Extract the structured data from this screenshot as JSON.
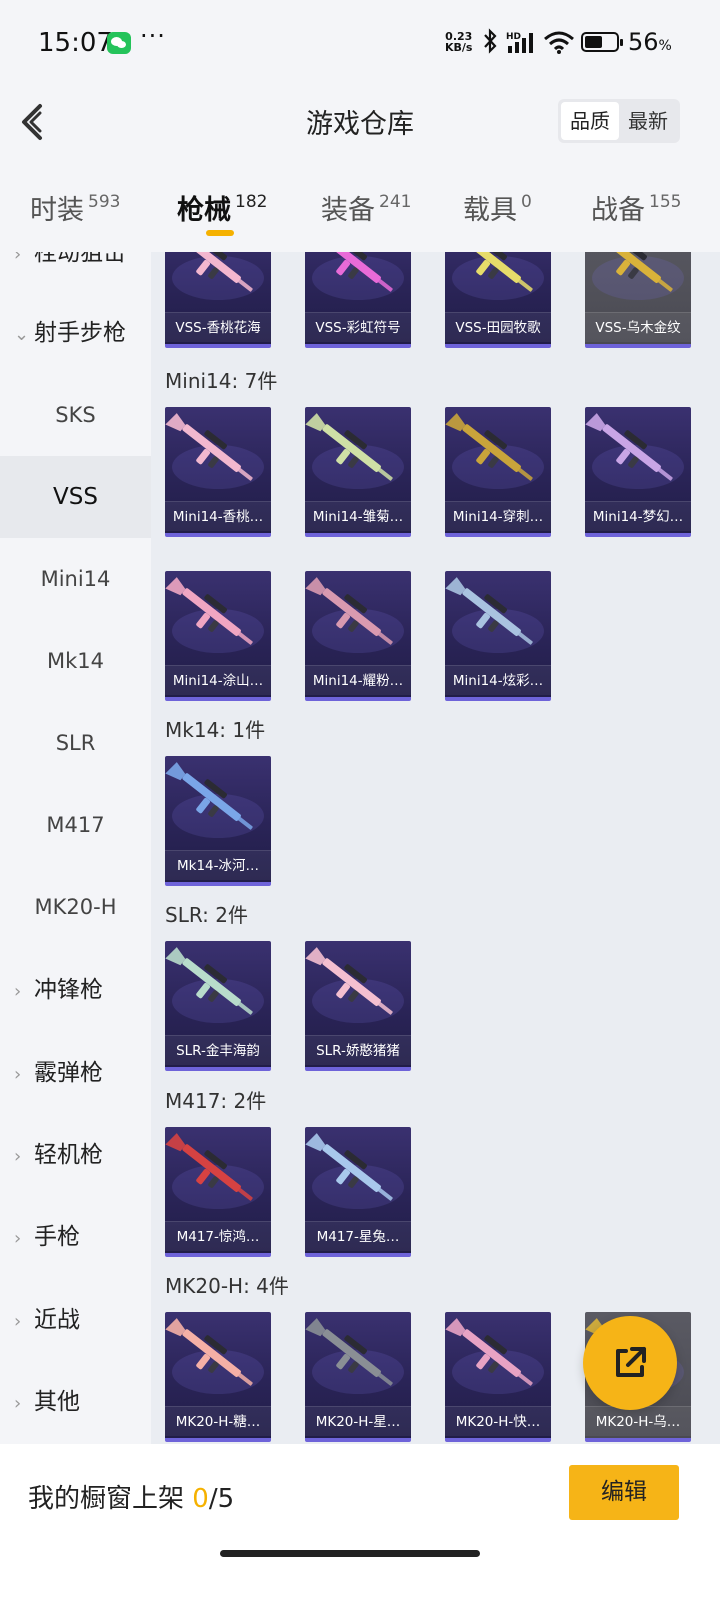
{
  "status_bar": {
    "time": "15:07",
    "dots": "···",
    "net_speed_value": "0.23",
    "net_speed_unit": "KB/s",
    "signal_label": "HD",
    "battery_percent": "56",
    "battery_unit": "%",
    "battery_level": 0.56
  },
  "header": {
    "title": "游戏仓库",
    "sort_options": [
      "品质",
      "最新"
    ],
    "sort_active": "品质"
  },
  "tabs": [
    {
      "label": "时装",
      "count": "593"
    },
    {
      "label": "枪械",
      "count": "182",
      "active": true
    },
    {
      "label": "装备",
      "count": "241"
    },
    {
      "label": "载具",
      "count": "0"
    },
    {
      "label": "战备",
      "count": "155"
    }
  ],
  "sidebar": {
    "partial_top": "栓动狙击",
    "expanded_category": "射手步枪",
    "sub_items": [
      "SKS",
      "VSS",
      "Mini14",
      "Mk14",
      "SLR",
      "M417",
      "MK20-H"
    ],
    "active_sub_item": "VSS",
    "collapsed_categories": [
      "冲锋枪",
      "霰弹枪",
      "轻机枪",
      "手枪",
      "近战",
      "其他"
    ]
  },
  "content": {
    "vss_row": [
      {
        "name": "VSS-香桃花海",
        "color": "#f3b7cf"
      },
      {
        "name": "VSS-彩虹符号",
        "color": "#e86bd8"
      },
      {
        "name": "VSS-田园牧歌",
        "color": "#e6dc6a"
      },
      {
        "name": "VSS-乌木金纹",
        "color": "#d9b23a"
      }
    ],
    "groups": [
      {
        "title": "Mini14: 7件",
        "items": [
          {
            "name": "Mini14-香桃…",
            "color": "#f2b8cf"
          },
          {
            "name": "Mini14-雏菊…",
            "color": "#cfe0a6"
          },
          {
            "name": "Mini14-穿刺…",
            "color": "#c9a43b"
          },
          {
            "name": "Mini14-梦幻…",
            "color": "#c9a5e6"
          },
          {
            "name": "Mini14-涂山…",
            "color": "#f0a6c2"
          },
          {
            "name": "Mini14-耀粉…",
            "color": "#d99ab0"
          },
          {
            "name": "Mini14-炫彩…",
            "color": "#a9c3e0"
          }
        ]
      },
      {
        "title": "Mk14: 1件",
        "items": [
          {
            "name": "Mk14-冰河…",
            "color": "#7aa6e8"
          }
        ]
      },
      {
        "title": "SLR: 2件",
        "items": [
          {
            "name": "SLR-金丰海韵",
            "color": "#b8dccb"
          },
          {
            "name": "SLR-娇憨猪猪",
            "color": "#f4bfd0"
          }
        ]
      },
      {
        "title": "M417: 2件",
        "items": [
          {
            "name": "M417-惊鸿…",
            "color": "#d64242"
          },
          {
            "name": "M417-星兔…",
            "color": "#a8c8ec"
          }
        ]
      },
      {
        "title": "MK20-H: 4件",
        "items": [
          {
            "name": "MK20-H-糖…",
            "color": "#f5b0a6"
          },
          {
            "name": "MK20-H-星…",
            "color": "#8a8f95"
          },
          {
            "name": "MK20-H-快…",
            "color": "#e8a3c4"
          },
          {
            "name": "MK20-H-乌…",
            "color": "#d9b23a"
          }
        ]
      }
    ]
  },
  "bottom_bar": {
    "shelf_label": "我的橱窗上架",
    "shelf_current": "0",
    "shelf_total": "/5",
    "edit_label": "编辑"
  },
  "colors": {
    "accent": "#f6b417",
    "card_bg": "#2a2457",
    "card_border": "#6e63d9"
  }
}
